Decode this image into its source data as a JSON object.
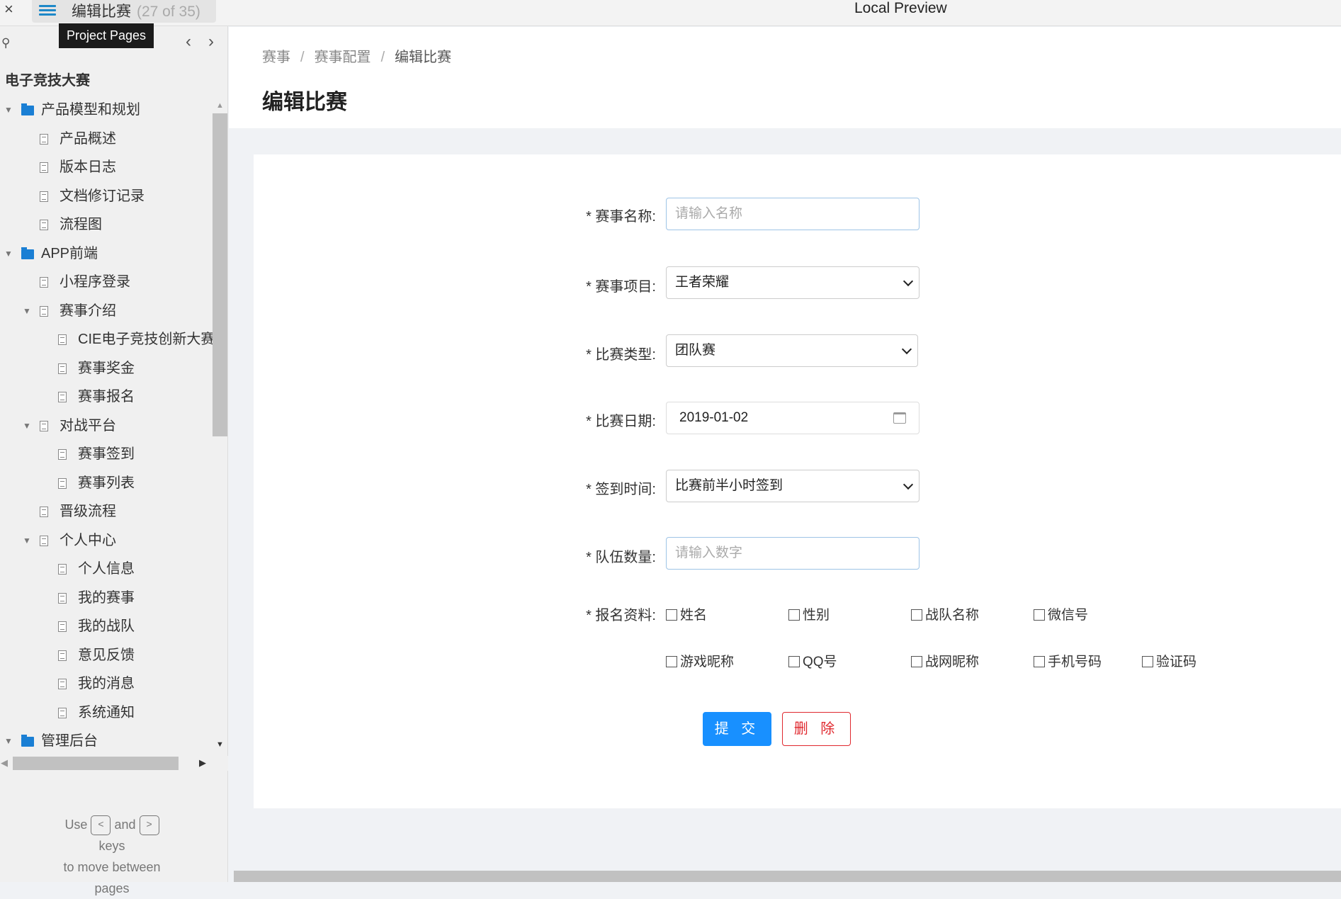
{
  "topbar": {
    "page_title": "编辑比赛",
    "page_count": "(27 of 35)",
    "preview_title": "Local Preview",
    "tooltip": "Project Pages",
    "close": "×"
  },
  "sidebar": {
    "project": "电子竞技大赛",
    "items": [
      {
        "label": "产品模型和规划",
        "level": 0,
        "type": "folder",
        "expanded": true
      },
      {
        "label": "产品概述",
        "level": 1,
        "type": "page"
      },
      {
        "label": "版本日志",
        "level": 1,
        "type": "page"
      },
      {
        "label": "文档修订记录",
        "level": 1,
        "type": "page"
      },
      {
        "label": "流程图",
        "level": 1,
        "type": "page"
      },
      {
        "label": "APP前端",
        "level": 0,
        "type": "folder",
        "expanded": true
      },
      {
        "label": "小程序登录",
        "level": 1,
        "type": "page"
      },
      {
        "label": "赛事介绍",
        "level": 1,
        "type": "page",
        "expanded": true
      },
      {
        "label": "CIE电子竞技创新大赛",
        "level": 2,
        "type": "page"
      },
      {
        "label": "赛事奖金",
        "level": 2,
        "type": "page"
      },
      {
        "label": "赛事报名",
        "level": 2,
        "type": "page"
      },
      {
        "label": "对战平台",
        "level": 1,
        "type": "page",
        "expanded": true
      },
      {
        "label": "赛事签到",
        "level": 2,
        "type": "page"
      },
      {
        "label": "赛事列表",
        "level": 2,
        "type": "page"
      },
      {
        "label": "晋级流程",
        "level": 1,
        "type": "page"
      },
      {
        "label": "个人中心",
        "level": 1,
        "type": "page",
        "expanded": true
      },
      {
        "label": "个人信息",
        "level": 2,
        "type": "page"
      },
      {
        "label": "我的赛事",
        "level": 2,
        "type": "page"
      },
      {
        "label": "我的战队",
        "level": 2,
        "type": "page"
      },
      {
        "label": "意见反馈",
        "level": 2,
        "type": "page"
      },
      {
        "label": "我的消息",
        "level": 2,
        "type": "page"
      },
      {
        "label": "系统通知",
        "level": 2,
        "type": "page"
      },
      {
        "label": "管理后台",
        "level": 0,
        "type": "folder",
        "expanded": true
      }
    ],
    "help": {
      "use": "Use",
      "prev_key": "<",
      "and": "and",
      "next_key": ">",
      "keys": "keys",
      "move": "to move between",
      "pages": "pages"
    }
  },
  "breadcrumb": [
    "赛事",
    "赛事配置",
    "编辑比赛"
  ],
  "heading": "编辑比赛",
  "form": {
    "name": {
      "label": "* 赛事名称:",
      "placeholder": "请输入名称"
    },
    "game": {
      "label": "* 赛事项目:",
      "value": "王者荣耀"
    },
    "type": {
      "label": "* 比赛类型:",
      "value": "团队赛"
    },
    "date": {
      "label": "* 比赛日期:",
      "value": "2019-01-02"
    },
    "checkin": {
      "label": "* 签到时间:",
      "value": "比赛前半小时签到"
    },
    "teams": {
      "label": "* 队伍数量:",
      "placeholder": "请输入数字"
    },
    "info": {
      "label": "* 报名资料:",
      "options": [
        "姓名",
        "性别",
        "战队名称",
        "微信号",
        "游戏昵称",
        "QQ号",
        "战网昵称",
        "手机号码",
        "验证码"
      ]
    },
    "submit": "提 交",
    "delete": "删 除"
  },
  "colors": {
    "primary": "#1890ff",
    "danger": "#e0282e",
    "folder": "#1a7fd4"
  }
}
